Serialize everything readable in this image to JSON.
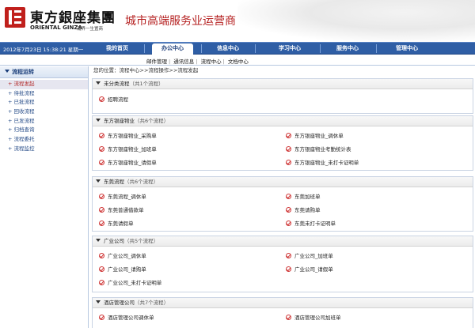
{
  "brand": {
    "name_cn": "東方銀座集團",
    "name_en": "ORIENTAL GINZA",
    "tagline": "涌界一生置商",
    "slogan": "城市高端服务业运营商"
  },
  "nav": {
    "datetime": "2012年7月23日 15:38:21 星期一",
    "items": [
      "我的首页",
      "办公中心",
      "信息中心",
      "学习中心",
      "服务中心",
      "管理中心"
    ],
    "active": "办公中心"
  },
  "subnav": [
    "邮件管理",
    "通讯信息",
    "流程中心",
    "文档中心"
  ],
  "sidebar": {
    "title": "流程运转",
    "items": [
      "流程发起",
      "待批流程",
      "已批流程",
      "回收流程",
      "已发流程",
      "归档查询",
      "流程委托",
      "流程监控"
    ]
  },
  "breadcrumb": "您的位置：流程中心>>流程操作>>流程发起",
  "sections": [
    {
      "title": "未分类流程",
      "count": "（共1个流程）",
      "flows": [
        "招聘流程"
      ]
    },
    {
      "title": "东方银座物业",
      "count": "（共6个流程）",
      "flows": [
        "东方银座物业_采购单",
        "东方银座物业_调休单",
        "东方银座物业_加班单",
        "东方银座物业考勤统计表",
        "东方银座物业_请假单",
        "东方银座物业_未打卡证明单"
      ]
    },
    {
      "title": "东莞流程",
      "count": "（共6个流程）",
      "flows": [
        "东莞流程_调休单",
        "东莞加班单",
        "东莞普通借款单",
        "东莞请购单",
        "东莞请假单",
        "东莞未打卡证明单"
      ]
    },
    {
      "title": "广业公司",
      "count": "（共5个流程）",
      "flows": [
        "广业公司_调休单",
        "广业公司_加班单",
        "广业公司_请购单",
        "广业公司_请假单",
        "广业公司_未打卡证明单"
      ]
    },
    {
      "title": "酒店管理公司",
      "count": "（共7个流程）",
      "flows": [
        "酒店管理公司调休单",
        "酒店管理公司加班单"
      ]
    }
  ],
  "colors": {
    "nav_bg": "#2f5ea5",
    "brand_red": "#c0201c",
    "sidebar_active": "#b32b2b"
  }
}
